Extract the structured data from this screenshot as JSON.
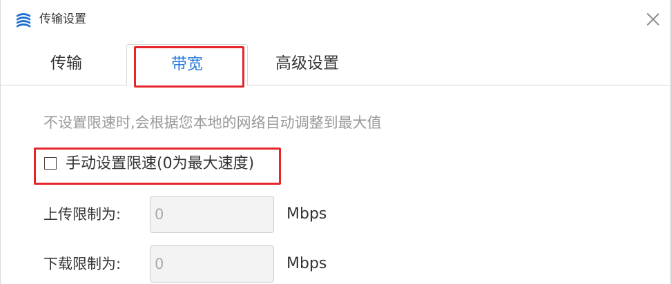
{
  "window": {
    "title": "传输设置",
    "icon": "stacked-disks-icon",
    "close_icon": "close-icon"
  },
  "tabs": [
    {
      "label": "传输",
      "selected": false
    },
    {
      "label": "带宽",
      "selected": true
    },
    {
      "label": "高级设置",
      "selected": false
    }
  ],
  "bandwidth": {
    "hint": "不设置限速时,会根据您本地的网络自动调整到最大值",
    "manual_limit": {
      "label": "手动设置限速(0为最大速度)",
      "checked": false
    },
    "upload": {
      "label": "上传限制为:",
      "value": "0",
      "unit": "Mbps"
    },
    "download": {
      "label": "下载限制为:",
      "value": "0",
      "unit": "Mbps"
    }
  },
  "colors": {
    "accent_blue": "#2b7bdc",
    "highlight_red": "#e5252a",
    "hint_gray": "#999999"
  }
}
